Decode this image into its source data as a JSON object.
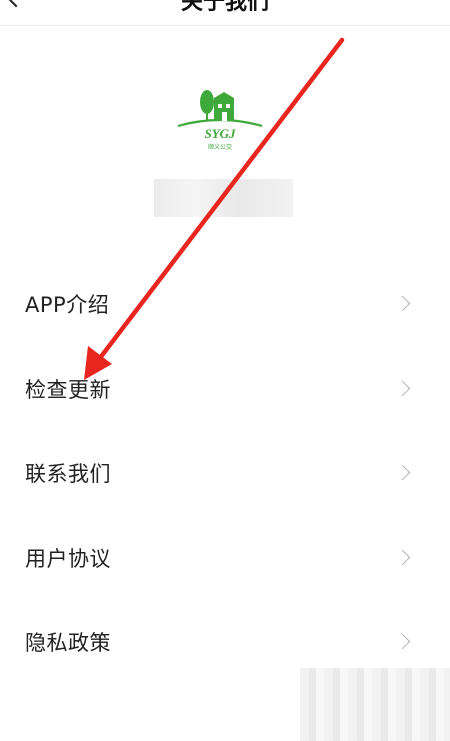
{
  "header": {
    "title": "关于我们"
  },
  "logo": {
    "text": "SYGJ",
    "subtitle": "顺义公交"
  },
  "menu": {
    "items": [
      {
        "label": "APP介绍"
      },
      {
        "label": "检查更新"
      },
      {
        "label": "联系我们"
      },
      {
        "label": "用户协议"
      },
      {
        "label": "隐私政策"
      }
    ]
  },
  "colors": {
    "brand_green": "#3fa83a",
    "arrow_red": "#e8261f",
    "chevron": "#b3b3b3"
  }
}
